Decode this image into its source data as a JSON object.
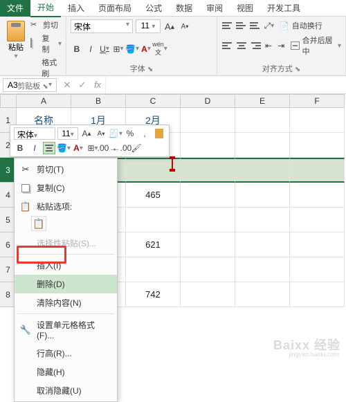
{
  "tabs": {
    "file": "文件",
    "home": "开始",
    "insert": "插入",
    "layout": "页面布局",
    "formulas": "公式",
    "data": "数据",
    "review": "审阅",
    "view": "视图",
    "developer": "开发工具"
  },
  "ribbon": {
    "clipboard": {
      "label": "剪贴板",
      "paste": "粘贴",
      "cut": "剪切",
      "copy": "复制",
      "painter": "格式刷"
    },
    "font": {
      "label": "字体",
      "name": "宋体",
      "size": "11",
      "increase": "A",
      "decrease": "A"
    },
    "align": {
      "label": "对齐方式",
      "wrap": "自动换行",
      "merge": "合并后居中"
    }
  },
  "name_box": "A3",
  "columns": [
    "A",
    "B",
    "C",
    "D",
    "E",
    "F"
  ],
  "rows": [
    "1",
    "2",
    "3",
    "4",
    "5",
    "6",
    "7",
    "8"
  ],
  "cells": {
    "A1": "名称",
    "B1": "1月",
    "C1": "2月",
    "C4": "465",
    "C6": "621",
    "C8": "742"
  },
  "mini_toolbar": {
    "font": "宋体",
    "size": "11"
  },
  "context_menu": {
    "cut": "剪切(T)",
    "copy": "复制(C)",
    "paste_options": "粘贴选项:",
    "paste_special": "选择性粘贴(S)...",
    "insert": "插入(I)",
    "delete": "删除(D)",
    "clear": "清除内容(N)",
    "format_cells": "设置单元格格式(F)...",
    "row_height": "行高(R)...",
    "hide": "隐藏(H)",
    "unhide": "取消隐藏(U)"
  },
  "watermark": "Baixx 经验",
  "watermark_sub": "jingyan.baidu.com"
}
